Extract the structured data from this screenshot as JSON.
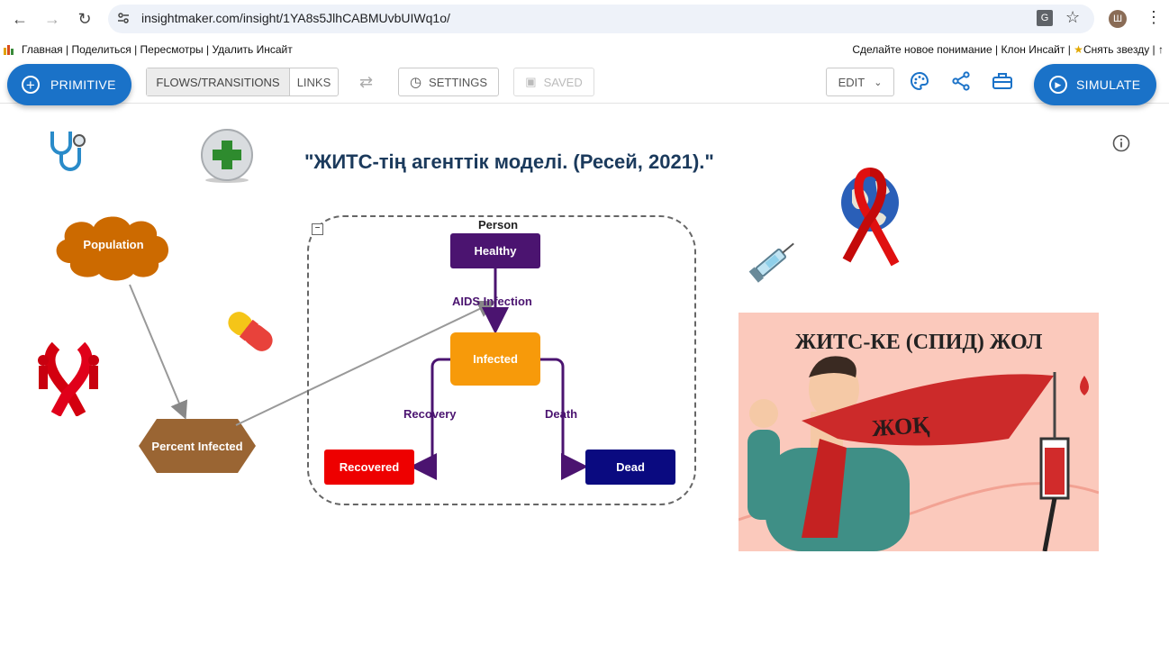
{
  "browser": {
    "url": "insightmaker.com/insight/1YA8s5JlhCABMUvbUIWq1o/",
    "avatar_letter": "Ш"
  },
  "links": {
    "left": [
      "Главная",
      "Поделиться",
      "Пересмотры",
      "Удалить Инсайт"
    ],
    "right": [
      "Сделайте новое понимание",
      "Клон Инсайт",
      "Снять звезду"
    ]
  },
  "toolbar": {
    "primitive": "PRIMITIVE",
    "flows": "FLOWS/TRANSITIONS",
    "links": "LINKS",
    "settings": "SETTINGS",
    "saved": "SAVED",
    "edit": "EDIT",
    "simulate": "SIMULATE"
  },
  "model": {
    "title": "\"ЖИТС-тің агенттік моделі. (Ресей, 2021).\"",
    "population": "Population",
    "percent_infected": "Percent Infected",
    "agent_label": "Person",
    "healthy": "Healthy",
    "infected": "Infected",
    "recovered": "Recovered",
    "dead": "Dead",
    "aids_infection": "AIDS Infection",
    "recovery": "Recovery",
    "death": "Death"
  },
  "banner": {
    "headline": "ЖИТС-КЕ (СПИД) ЖОЛ",
    "scarf_word": "ЖОҚ"
  },
  "colors": {
    "brand_blue": "#1a72c8",
    "healthy": "#4b1470",
    "infected": "#f79a0a",
    "recovered": "#ee0000",
    "dead": "#0a0a80",
    "population": "#cc6a00",
    "percent_infected": "#9a6533"
  }
}
